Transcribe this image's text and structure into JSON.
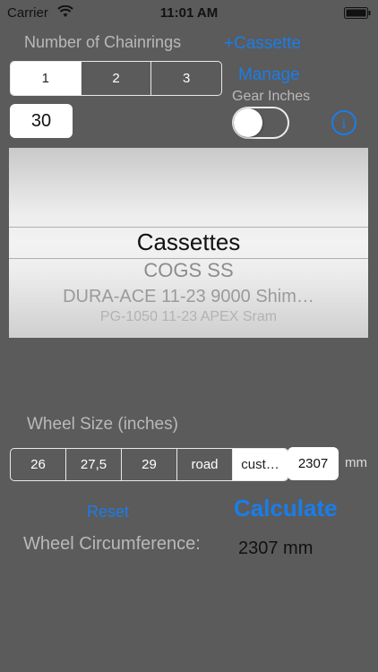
{
  "status_bar": {
    "carrier": "Carrier",
    "time": "11:01 AM"
  },
  "chainrings": {
    "label": "Number of Chainrings",
    "options": [
      "1",
      "2",
      "3"
    ],
    "selected_index": 0,
    "teeth_value": "30"
  },
  "links": {
    "add_cassette": "+Cassette",
    "manage": "Manage"
  },
  "gear_inches": {
    "label": "Gear Inches",
    "enabled": false
  },
  "info": {
    "glyph": "i"
  },
  "picker": {
    "selected": "Cassettes",
    "items": [
      "COGS SS",
      "DURA-ACE 11-23 9000 Shim…",
      "PG-1050 11-23 APEX Sram"
    ]
  },
  "wheel": {
    "label": "Wheel Size (inches)",
    "options": [
      "26",
      "27,5",
      "29",
      "road",
      "cust…"
    ],
    "selected_index": 4,
    "custom_value": "2307",
    "unit": "mm"
  },
  "actions": {
    "reset": "Reset",
    "calculate": "Calculate"
  },
  "result": {
    "label": "Wheel Circumference:",
    "value": "2307 mm"
  },
  "colors": {
    "background": "#5b5b5b",
    "accent": "#1a7dea",
    "label": "#b9b9b9"
  }
}
